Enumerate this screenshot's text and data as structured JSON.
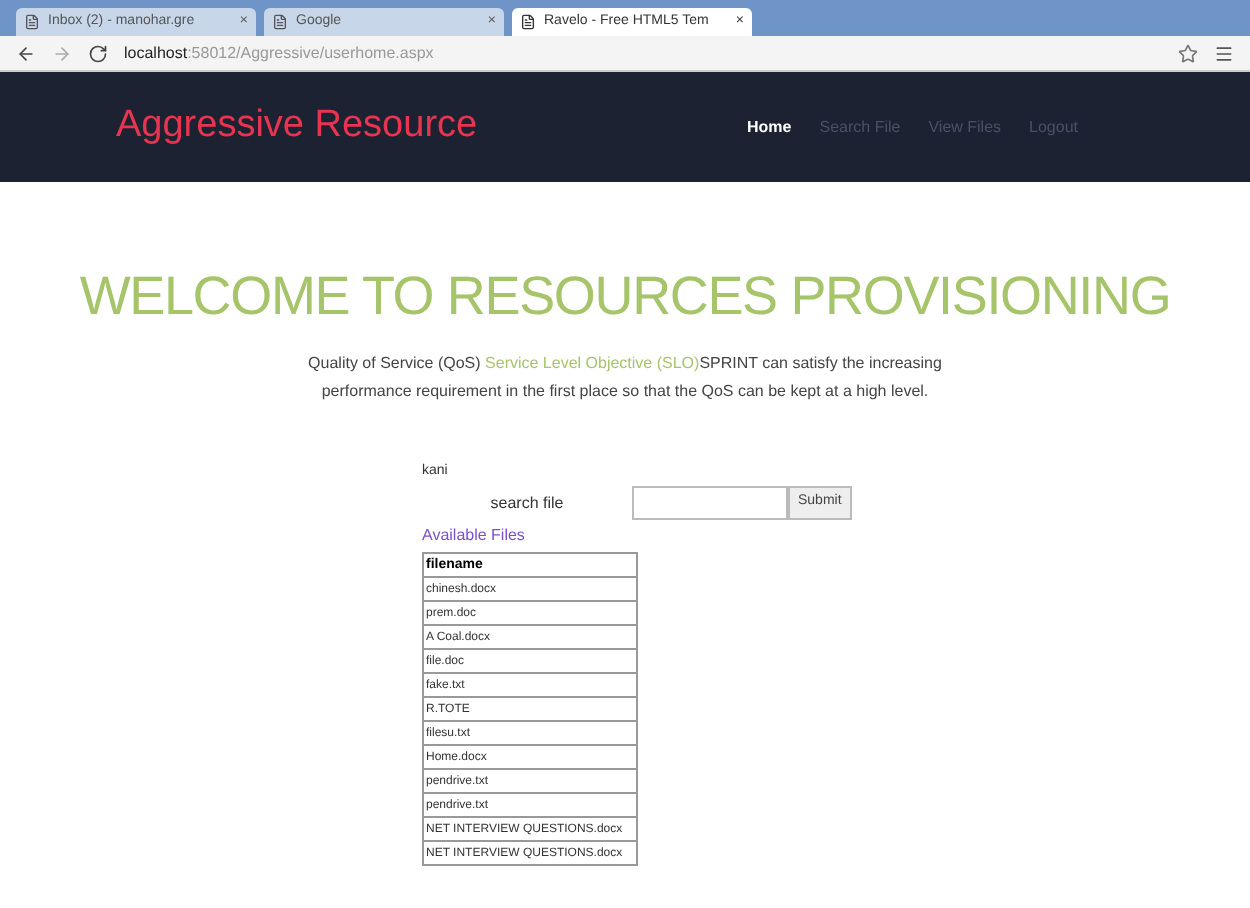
{
  "browser": {
    "tabs": [
      {
        "label": "Inbox (2) - manohar.gre",
        "selected": false
      },
      {
        "label": "Google",
        "selected": false
      },
      {
        "label": "Ravelo - Free HTML5 Tem",
        "selected": true
      }
    ],
    "close_mark": "×",
    "url_host": "localhost",
    "url_path": ":58012/Aggressive/userhome.aspx"
  },
  "navbar": {
    "brand": "Aggressive Resource",
    "links": [
      {
        "label": "Home",
        "selected": true
      },
      {
        "label": "Search File",
        "selected": false
      },
      {
        "label": "View Files",
        "selected": false
      },
      {
        "label": "Logout",
        "selected": false
      }
    ]
  },
  "hero": {
    "title": "WELCOME TO RESOURCES PROVISIONING",
    "text_start": "Quality of Service (QoS)",
    "text_link": "Service Level Objective (SLO)",
    "text_end": "SPRINT can satisfy the increasing performance requirement in the first place so that the QoS can be kept at a high level."
  },
  "user": "kani",
  "search": {
    "label": "search file",
    "button": "Submit"
  },
  "files": {
    "heading": "Available Files",
    "column": "filename",
    "rows": [
      "chinesh.docx",
      "prem.doc",
      "A Coal.docx",
      "file.doc",
      "fake.txt",
      "R.TOTE",
      "filesu.txt",
      "Home.docx",
      "pendrive.txt",
      "pendrive.txt",
      "NET INTERVIEW QUESTIONS.docx",
      "NET INTERVIEW QUESTIONS.docx"
    ]
  }
}
